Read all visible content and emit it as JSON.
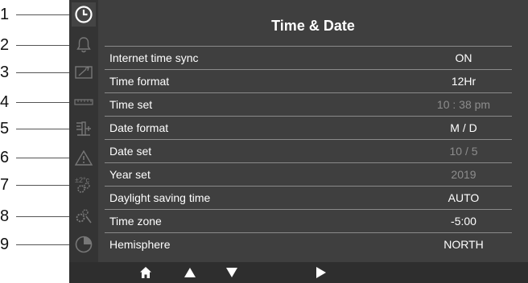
{
  "callouts": [
    "1",
    "2",
    "3",
    "4",
    "5",
    "6",
    "7",
    "8",
    "9"
  ],
  "sidebar": {
    "icons": [
      "clock-icon",
      "bell-icon",
      "screwdriver-icon",
      "ruler-icon",
      "sensor-icon",
      "warning-icon",
      "temperature-calibration-icon",
      "settings-gears-icon",
      "pie-chart-icon"
    ],
    "calibration_text": "±2°c",
    "active": "clock-icon"
  },
  "header": {
    "title": "Time & Date"
  },
  "rows": [
    {
      "label": "Internet time sync",
      "value": "ON",
      "dim": false
    },
    {
      "label": "Time format",
      "value": "12Hr",
      "dim": false
    },
    {
      "label": "Time set",
      "value": "10 : 38 pm",
      "dim": true
    },
    {
      "label": "Date format",
      "value": "M / D",
      "dim": false
    },
    {
      "label": "Date set",
      "value": "10 / 5",
      "dim": true
    },
    {
      "label": "Year set",
      "value": "2019",
      "dim": true
    },
    {
      "label": "Daylight saving time",
      "value": "AUTO",
      "dim": false
    },
    {
      "label": "Time zone",
      "value": "-5:00",
      "dim": false
    },
    {
      "label": "Hemisphere",
      "value": "NORTH",
      "dim": false
    }
  ],
  "bottombar": {
    "buttons": [
      "home-icon",
      "up-arrow-icon",
      "down-arrow-icon",
      "right-arrow-icon"
    ]
  },
  "colors": {
    "screen_bg": "#3f3f3f",
    "sidebar_bg": "#343434",
    "text": "#ffffff",
    "dim_text": "#8d8d8d",
    "divider": "#8a8a8a"
  }
}
